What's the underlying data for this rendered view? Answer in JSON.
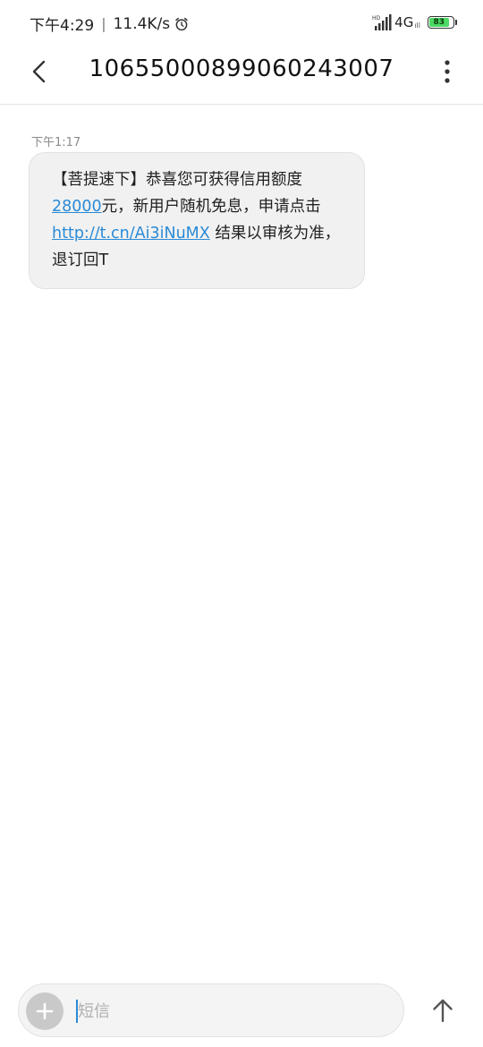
{
  "status_bar": {
    "time": "下午4:29",
    "separator": "|",
    "net_speed": "11.4K/s",
    "hd_label": "HD",
    "network": "4G",
    "network_sub": "ıll",
    "battery": "83",
    "battery_level": 0.83
  },
  "header": {
    "title": "10655000899060243007"
  },
  "message": {
    "time": "下午1:17",
    "text_1": "【菩提速下】恭喜您可获得信用额度",
    "amount_link": "28000",
    "text_2": "元，新用户随机免息，申请点击",
    "url_link": "http://t.cn/Ai3iNuMX",
    "text_3": " 结果以审核为准，退订回T"
  },
  "compose": {
    "placeholder": "短信"
  },
  "colors": {
    "link": "#2a8ad6",
    "bubble_bg": "#f1f1f1",
    "battery_fill": "#4cd964"
  },
  "icons": {
    "back": "chevron-left-icon",
    "more": "more-vertical-icon",
    "add": "plus-icon",
    "send": "arrow-up-icon",
    "alarm": "alarm-clock-icon",
    "signal": "signal-icon"
  }
}
